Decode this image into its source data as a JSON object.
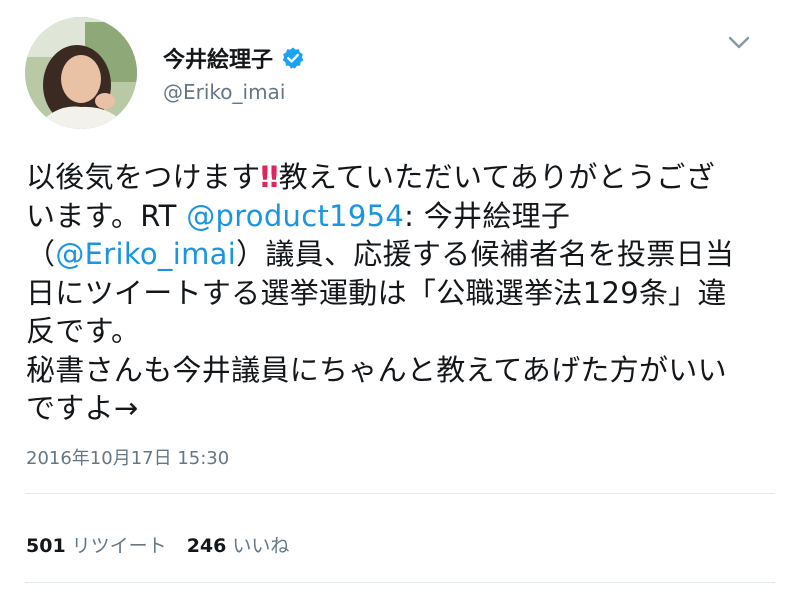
{
  "user": {
    "display_name": "今井絵理子",
    "handle": "@Eriko_imai",
    "verified": true
  },
  "tweet": {
    "lines": [
      {
        "pre": "以後気をつけます",
        "emoji": "‼",
        "post": "教えていただいてありがとうござ"
      },
      {
        "pre": "います。RT ",
        "mention": "@product1954",
        "post": ": 今井絵理子"
      },
      {
        "pre": "（",
        "mention": "@Eriko_imai",
        "post": "）議員、応援する候補者名を投票日当"
      },
      {
        "text": "日にツイートする選挙運動は「公職選挙法129条」違"
      },
      {
        "text": "反です。"
      },
      {
        "text": "秘書さんも今井議員にちゃんと教えてあげた方がいい"
      },
      {
        "text": "ですよ→"
      }
    ]
  },
  "timestamp": "2016年10月17日 15:30",
  "stats": {
    "retweets_count": "501",
    "retweets_label": "リツイート",
    "likes_count": "246",
    "likes_label": "いいね"
  },
  "colors": {
    "link": "#1b95e0",
    "secondary_text": "#657786",
    "verified_badge": "#1da1f2",
    "emoji": "#e0245e"
  },
  "icons": {
    "verified": "verified-badge-icon",
    "menu": "chevron-down-icon",
    "emoji": "double-exclamation-icon"
  }
}
